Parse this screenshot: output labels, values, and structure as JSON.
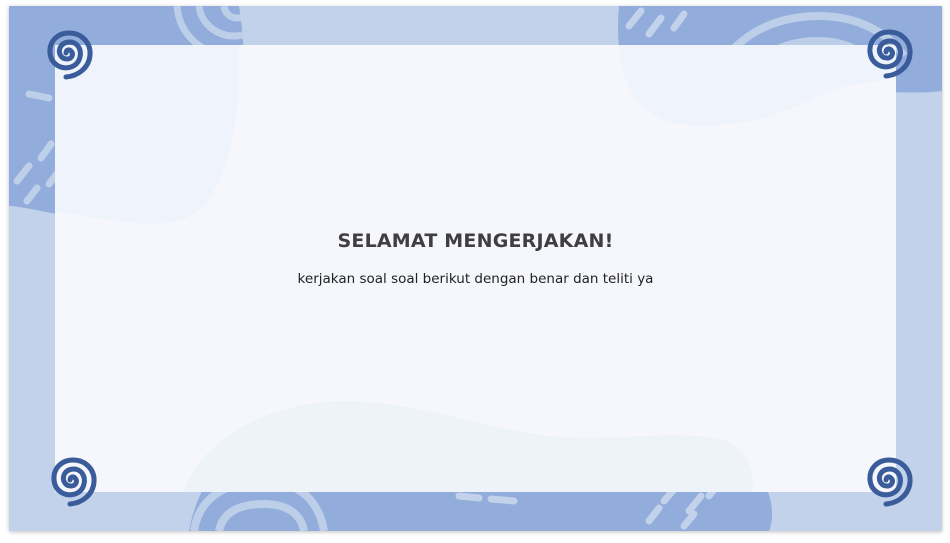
{
  "slide": {
    "title": "SELAMAT MENGERJAKAN!",
    "subtitle": "kerjakan soal soal berikut dengan benar dan teliti ya"
  },
  "colors": {
    "frame_light": "#c1d2ea",
    "blob_blue": "#92acdb",
    "panel": "#f5f7fc",
    "spiral": "#3a5c9a",
    "title_text": "#3f3f3f",
    "subtitle_text": "#222222"
  },
  "icons": {
    "corner": "spiral-icon"
  }
}
